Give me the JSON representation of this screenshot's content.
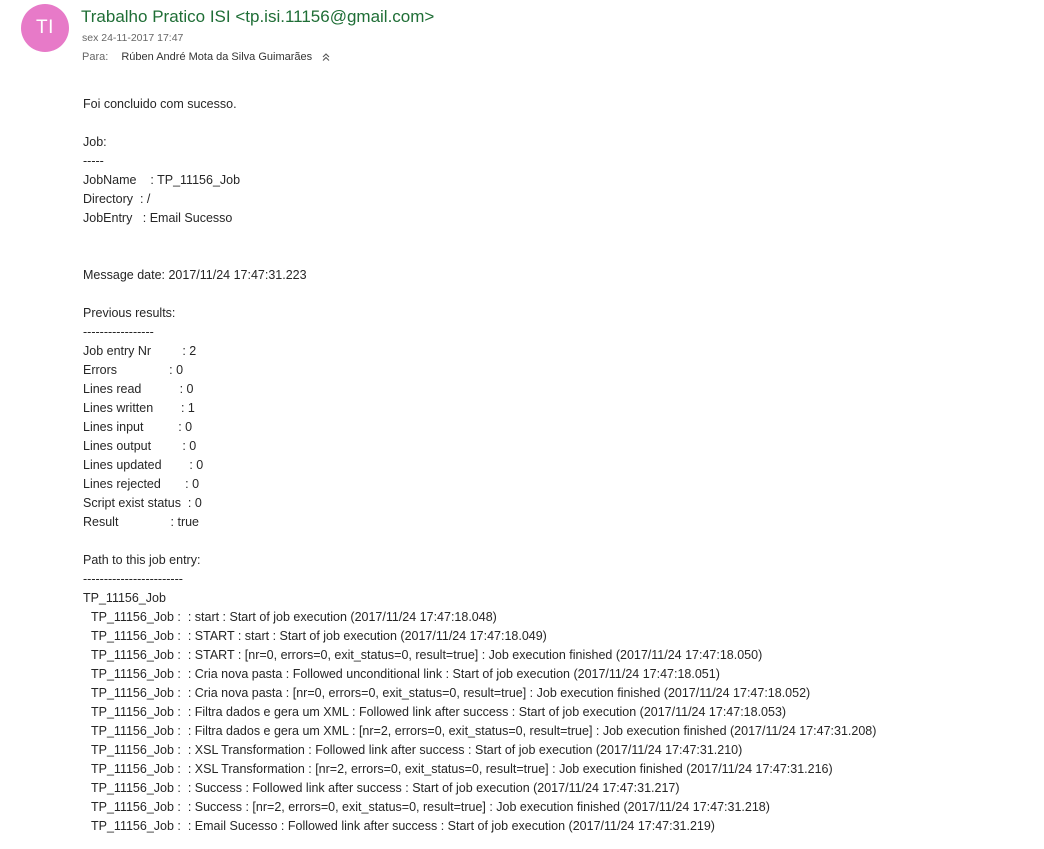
{
  "header": {
    "avatar_initials": "TI",
    "avatar_color": "#e77ac8",
    "sender_name": "Trabalho Pratico ISI",
    "sender_email": "<tp.isi.11156@gmail.com>",
    "date": "sex 24-11-2017 17:47",
    "to_label": "Para:",
    "to_recipient": "Rúben André Mota da Silva Guimarães"
  },
  "body": {
    "lines": [
      "Foi concluido com sucesso.",
      "",
      "Job:",
      "-----",
      "JobName    : TP_11156_Job",
      "Directory  : /",
      "JobEntry   : Email Sucesso",
      "",
      "",
      "Message date: 2017/11/24 17:47:31.223",
      "",
      "Previous results:",
      "-----------------",
      "Job entry Nr         : 2",
      "Errors               : 0",
      "Lines read           : 0",
      "Lines written        : 1",
      "Lines input          : 0",
      "Lines output         : 0",
      "Lines updated        : 0",
      "Lines rejected       : 0",
      "Script exist status  : 0",
      "Result               : true",
      "",
      "Path to this job entry:",
      "------------------------",
      "TP_11156_Job"
    ],
    "path_entries": [
      "TP_11156_Job :  : start : Start of job execution (2017/11/24 17:47:18.048)",
      "TP_11156_Job :  : START : start : Start of job execution (2017/11/24 17:47:18.049)",
      "TP_11156_Job :  : START : [nr=0, errors=0, exit_status=0, result=true] : Job execution finished (2017/11/24 17:47:18.050)",
      "TP_11156_Job :  : Cria nova pasta : Followed unconditional link : Start of job execution (2017/11/24 17:47:18.051)",
      "TP_11156_Job :  : Cria nova pasta : [nr=0, errors=0, exit_status=0, result=true] : Job execution finished (2017/11/24 17:47:18.052)",
      "TP_11156_Job :  : Filtra dados e gera um XML : Followed link after success : Start of job execution (2017/11/24 17:47:18.053)",
      "TP_11156_Job :  : Filtra dados e gera um XML : [nr=2, errors=0, exit_status=0, result=true] : Job execution finished (2017/11/24 17:47:31.208)",
      "TP_11156_Job :  : XSL Transformation : Followed link after success : Start of job execution (2017/11/24 17:47:31.210)",
      "TP_11156_Job :  : XSL Transformation : [nr=2, errors=0, exit_status=0, result=true] : Job execution finished (2017/11/24 17:47:31.216)",
      "TP_11156_Job :  : Success : Followed link after success : Start of job execution (2017/11/24 17:47:31.217)",
      "TP_11156_Job :  : Success : [nr=2, errors=0, exit_status=0, result=true] : Job execution finished (2017/11/24 17:47:31.218)",
      "TP_11156_Job :  : Email Sucesso : Followed link after success : Start of job execution (2017/11/24 17:47:31.219)"
    ]
  }
}
